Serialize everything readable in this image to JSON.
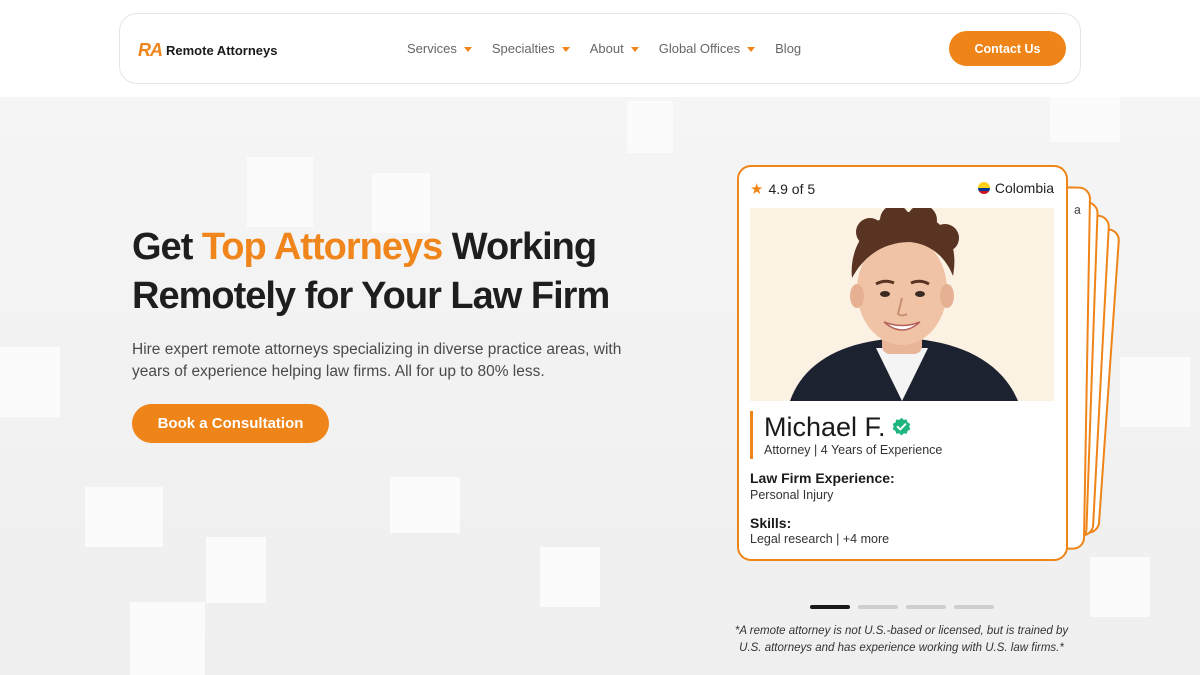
{
  "brand": {
    "mark": "RA",
    "name": "Remote Attorneys",
    "accent": "#ef8418"
  },
  "nav": {
    "items": [
      {
        "label": "Services",
        "dropdown": true
      },
      {
        "label": "Specialties",
        "dropdown": true
      },
      {
        "label": "About",
        "dropdown": true
      },
      {
        "label": "Global Offices",
        "dropdown": true
      },
      {
        "label": "Blog",
        "dropdown": false
      }
    ],
    "contact_label": "Contact Us"
  },
  "hero": {
    "title_pre": "Get ",
    "title_accent": "Top Attorneys",
    "title_post": " Working Remotely for Your Law Firm",
    "subtitle": "Hire expert remote attorneys specializing in diverse practice areas, with years of experience helping law firms. All for up to 80% less.",
    "cta_label": "Book a Consultation"
  },
  "card": {
    "rating": "4.9 of 5",
    "country": "Colombia",
    "name": "Michael F.",
    "role": "Attorney | 4 Years of Experience",
    "experience_label": "Law Firm Experience:",
    "experience_value": "Personal Injury",
    "skills_label": "Skills:",
    "skills_value": "Legal research | +4 more",
    "behind_card_partial_text": "a"
  },
  "carousel": {
    "total": 4,
    "active": 1
  },
  "disclaimer": "*A remote attorney is not U.S.-based or licensed, but is trained by U.S. attorneys and has experience working with U.S. law firms.*"
}
